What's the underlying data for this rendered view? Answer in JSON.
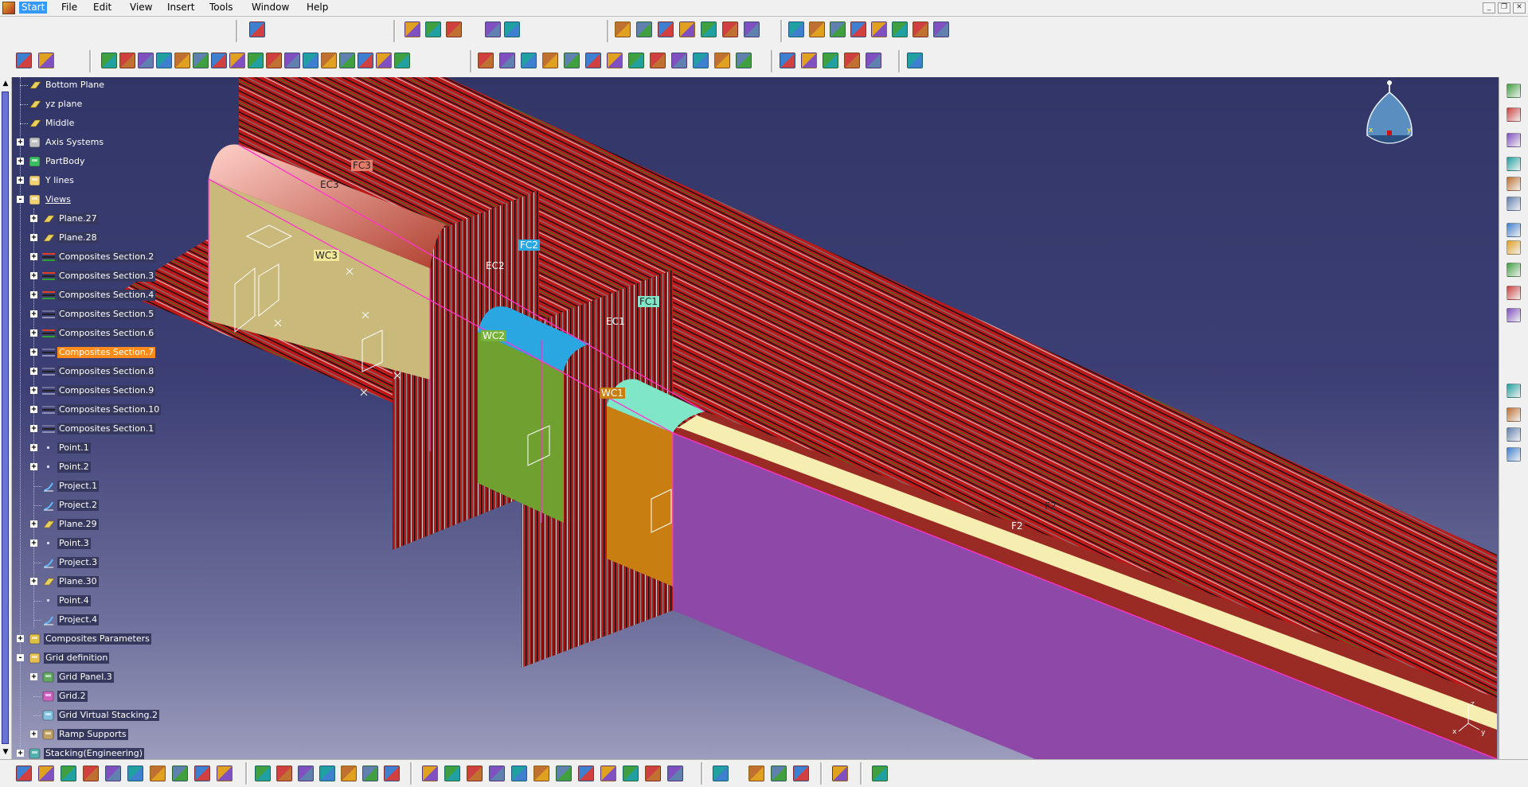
{
  "menu": {
    "items": [
      "Start",
      "File",
      "Edit",
      "View",
      "Insert",
      "Tools",
      "Window",
      "Help"
    ]
  },
  "window_controls": [
    "minimize-icon",
    "restore-icon",
    "close-icon"
  ],
  "tree": {
    "items": [
      {
        "label": "Bottom Plane",
        "level": 1,
        "icon": "plane-icon",
        "expander": false
      },
      {
        "label": "yz plane",
        "level": 1,
        "icon": "plane-icon",
        "expander": false
      },
      {
        "label": "Middle",
        "level": 1,
        "icon": "plane-icon",
        "expander": false
      },
      {
        "label": "Axis Systems",
        "level": 1,
        "icon": "axis-system-icon",
        "expander": "+"
      },
      {
        "label": "PartBody",
        "level": 1,
        "icon": "partbody-icon",
        "expander": "+"
      },
      {
        "label": "Y lines",
        "level": 1,
        "icon": "geometrical-set-icon",
        "expander": "+"
      },
      {
        "label": "Views",
        "level": 1,
        "icon": "geometrical-set-icon",
        "expander": "-",
        "style": "link"
      },
      {
        "label": "Plane.27",
        "level": 2,
        "icon": "plane-icon",
        "expander": "+"
      },
      {
        "label": "Plane.28",
        "level": 2,
        "icon": "plane-icon",
        "expander": "+"
      },
      {
        "label": "Composites Section.2",
        "level": 2,
        "icon": "composites-section-icon",
        "expander": "+"
      },
      {
        "label": "Composites Section.3",
        "level": 2,
        "icon": "composites-section-icon",
        "expander": "+"
      },
      {
        "label": "Composites Section.4",
        "level": 2,
        "icon": "composites-section-icon",
        "expander": "+"
      },
      {
        "label": "Composites Section.5",
        "level": 2,
        "icon": "composites-section-hidden-icon",
        "expander": "+"
      },
      {
        "label": "Composites Section.6",
        "level": 2,
        "icon": "composites-section-icon",
        "expander": "+"
      },
      {
        "label": "Composites Section.7",
        "level": 2,
        "icon": "composites-section-hidden-icon",
        "expander": "+",
        "style": "selected"
      },
      {
        "label": "Composites Section.8",
        "level": 2,
        "icon": "composites-section-hidden-icon",
        "expander": "+"
      },
      {
        "label": "Composites Section.9",
        "level": 2,
        "icon": "composites-section-hidden-icon",
        "expander": "+"
      },
      {
        "label": "Composites Section.10",
        "level": 2,
        "icon": "composites-section-hidden-icon",
        "expander": "+"
      },
      {
        "label": "Composites Section.1",
        "level": 2,
        "icon": "composites-section-hidden-icon",
        "expander": "+"
      },
      {
        "label": "Point.1",
        "level": 2,
        "icon": "point-icon",
        "expander": "+"
      },
      {
        "label": "Point.2",
        "level": 2,
        "icon": "point-icon",
        "expander": "+"
      },
      {
        "label": "Project.1",
        "level": 2,
        "icon": "projection-icon",
        "expander": false
      },
      {
        "label": "Project.2",
        "level": 2,
        "icon": "projection-icon",
        "expander": false
      },
      {
        "label": "Plane.29",
        "level": 2,
        "icon": "plane-icon",
        "expander": "+"
      },
      {
        "label": "Point.3",
        "level": 2,
        "icon": "point-icon",
        "expander": "+"
      },
      {
        "label": "Project.3",
        "level": 2,
        "icon": "projection-icon",
        "expander": false
      },
      {
        "label": "Plane.30",
        "level": 2,
        "icon": "plane-icon",
        "expander": "+"
      },
      {
        "label": "Point.4",
        "level": 2,
        "icon": "point-icon",
        "expander": false
      },
      {
        "label": "Project.4",
        "level": 2,
        "icon": "projection-icon",
        "expander": false
      },
      {
        "label": "Composites Parameters",
        "level": 1,
        "icon": "composites-parameters-icon",
        "expander": "+"
      },
      {
        "label": "Grid definition",
        "level": 1,
        "icon": "grid-definition-icon",
        "expander": "-"
      },
      {
        "label": "Grid Panel.3",
        "level": 2,
        "icon": "grid-panel-icon",
        "expander": "+"
      },
      {
        "label": "Grid.2",
        "level": 2,
        "icon": "grid-icon",
        "expander": false
      },
      {
        "label": "Grid Virtual Stacking.2",
        "level": 2,
        "icon": "virtual-stacking-icon",
        "expander": false
      },
      {
        "label": "Ramp Supports",
        "level": 2,
        "icon": "ramp-supports-icon",
        "expander": "+"
      },
      {
        "label": "Stacking(Engineering)",
        "level": 1,
        "icon": "stacking-icon",
        "expander": "+"
      }
    ]
  },
  "model_labels": [
    "FC3",
    "EC3",
    "WC3",
    "FC2",
    "EC2",
    "WC2",
    "FC1",
    "EC1",
    "WC1",
    "F2",
    "F2"
  ],
  "compass": {
    "axes": [
      "x",
      "y",
      "z"
    ]
  },
  "axis_triad": {
    "axes": [
      "z",
      "x",
      "y"
    ]
  },
  "colors": {
    "viewport_top": "#323667",
    "viewport_bottom": "#9c9cbd",
    "selected_node": "#ff8c1a",
    "ply_red": "#c01818",
    "fc3": "#e47b6b",
    "wc3": "#c9b97a",
    "fc2": "#2aa6e0",
    "wc2": "#6fa030",
    "fc1": "#7fe6c8",
    "wc1": "#c87e10",
    "web": "#8e49a8",
    "flange": "#9a2a24",
    "highlight": "#ff33cc"
  }
}
